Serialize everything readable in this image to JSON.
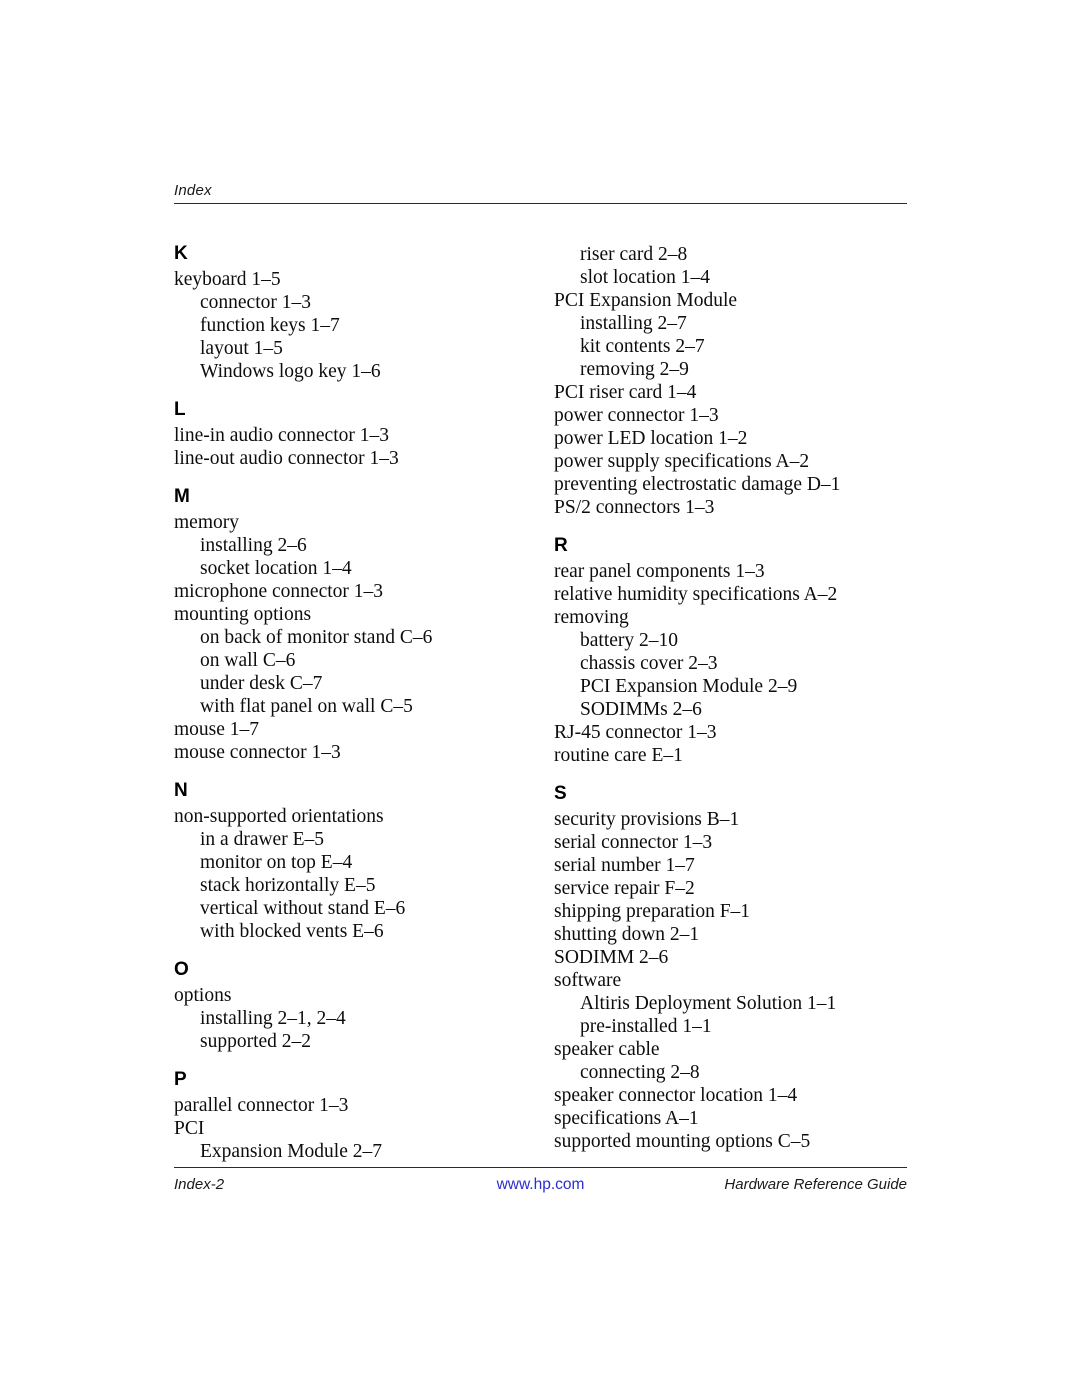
{
  "header": {
    "label": "Index"
  },
  "footer": {
    "left": "Index-2",
    "center": "www.hp.com",
    "right": "Hardware Reference Guide",
    "link_color": "#2c2cd4"
  },
  "columns": {
    "left": [
      {
        "type": "letter",
        "text": "K"
      },
      {
        "type": "entry",
        "level": 1,
        "text": "keyboard 1–5"
      },
      {
        "type": "entry",
        "level": 2,
        "text": "connector 1–3"
      },
      {
        "type": "entry",
        "level": 2,
        "text": "function keys 1–7"
      },
      {
        "type": "entry",
        "level": 2,
        "text": "layout 1–5"
      },
      {
        "type": "entry",
        "level": 2,
        "text": "Windows logo key 1–6"
      },
      {
        "type": "letter",
        "text": "L"
      },
      {
        "type": "entry",
        "level": 1,
        "text": "line-in audio connector 1–3"
      },
      {
        "type": "entry",
        "level": 1,
        "text": "line-out audio connector 1–3"
      },
      {
        "type": "letter",
        "text": "M"
      },
      {
        "type": "entry",
        "level": 1,
        "text": "memory"
      },
      {
        "type": "entry",
        "level": 2,
        "text": "installing 2–6"
      },
      {
        "type": "entry",
        "level": 2,
        "text": "socket location 1–4"
      },
      {
        "type": "entry",
        "level": 1,
        "text": "microphone connector 1–3"
      },
      {
        "type": "entry",
        "level": 1,
        "text": "mounting options"
      },
      {
        "type": "entry",
        "level": 2,
        "text": "on back of monitor stand C–6"
      },
      {
        "type": "entry",
        "level": 2,
        "text": "on wall C–6"
      },
      {
        "type": "entry",
        "level": 2,
        "text": "under desk C–7"
      },
      {
        "type": "entry",
        "level": 2,
        "text": "with flat panel on wall C–5"
      },
      {
        "type": "entry",
        "level": 1,
        "text": "mouse 1–7"
      },
      {
        "type": "entry",
        "level": 1,
        "text": "mouse connector 1–3"
      },
      {
        "type": "letter",
        "text": "N"
      },
      {
        "type": "entry",
        "level": 1,
        "text": "non-supported orientations"
      },
      {
        "type": "entry",
        "level": 2,
        "text": "in a drawer E–5"
      },
      {
        "type": "entry",
        "level": 2,
        "text": "monitor on top E–4"
      },
      {
        "type": "entry",
        "level": 2,
        "text": "stack horizontally E–5"
      },
      {
        "type": "entry",
        "level": 2,
        "text": "vertical without stand E–6"
      },
      {
        "type": "entry",
        "level": 2,
        "text": "with blocked vents E–6"
      },
      {
        "type": "letter",
        "text": "O"
      },
      {
        "type": "entry",
        "level": 1,
        "text": "options"
      },
      {
        "type": "entry",
        "level": 2,
        "text": "installing 2–1, 2–4"
      },
      {
        "type": "entry",
        "level": 2,
        "text": "supported 2–2"
      },
      {
        "type": "letter",
        "text": "P"
      },
      {
        "type": "entry",
        "level": 1,
        "text": "parallel connector 1–3"
      },
      {
        "type": "entry",
        "level": 1,
        "text": "PCI"
      },
      {
        "type": "entry",
        "level": 2,
        "text": "Expansion Module 2–7"
      }
    ],
    "right": [
      {
        "type": "entry",
        "level": 2,
        "text": "riser card 2–8"
      },
      {
        "type": "entry",
        "level": 2,
        "text": "slot location 1–4"
      },
      {
        "type": "entry",
        "level": 1,
        "text": "PCI Expansion Module"
      },
      {
        "type": "entry",
        "level": 2,
        "text": "installing 2–7"
      },
      {
        "type": "entry",
        "level": 2,
        "text": "kit contents 2–7"
      },
      {
        "type": "entry",
        "level": 2,
        "text": "removing 2–9"
      },
      {
        "type": "entry",
        "level": 1,
        "text": "PCI riser card 1–4"
      },
      {
        "type": "entry",
        "level": 1,
        "text": "power connector 1–3"
      },
      {
        "type": "entry",
        "level": 1,
        "text": "power LED location 1–2"
      },
      {
        "type": "entry",
        "level": 1,
        "text": "power supply specifications A–2"
      },
      {
        "type": "entry",
        "level": 1,
        "text": "preventing electrostatic damage D–1"
      },
      {
        "type": "entry",
        "level": 1,
        "text": "PS/2 connectors 1–3"
      },
      {
        "type": "letter",
        "text": "R"
      },
      {
        "type": "entry",
        "level": 1,
        "text": "rear panel components 1–3"
      },
      {
        "type": "entry",
        "level": 1,
        "text": "relative humidity specifications A–2"
      },
      {
        "type": "entry",
        "level": 1,
        "text": "removing"
      },
      {
        "type": "entry",
        "level": 2,
        "text": "battery 2–10"
      },
      {
        "type": "entry",
        "level": 2,
        "text": "chassis cover 2–3"
      },
      {
        "type": "entry",
        "level": 2,
        "text": "PCI Expansion Module 2–9"
      },
      {
        "type": "entry",
        "level": 2,
        "text": "SODIMMs 2–6"
      },
      {
        "type": "entry",
        "level": 1,
        "text": "RJ-45 connector 1–3"
      },
      {
        "type": "entry",
        "level": 1,
        "text": "routine care E–1"
      },
      {
        "type": "letter",
        "text": "S"
      },
      {
        "type": "entry",
        "level": 1,
        "text": "security provisions B–1"
      },
      {
        "type": "entry",
        "level": 1,
        "text": "serial connector 1–3"
      },
      {
        "type": "entry",
        "level": 1,
        "text": "serial number 1–7"
      },
      {
        "type": "entry",
        "level": 1,
        "text": "service repair F–2"
      },
      {
        "type": "entry",
        "level": 1,
        "text": "shipping preparation F–1"
      },
      {
        "type": "entry",
        "level": 1,
        "text": "shutting down 2–1"
      },
      {
        "type": "entry",
        "level": 1,
        "text": "SODIMM 2–6"
      },
      {
        "type": "entry",
        "level": 1,
        "text": "software"
      },
      {
        "type": "entry",
        "level": 2,
        "text": "Altiris Deployment Solution 1–1"
      },
      {
        "type": "entry",
        "level": 2,
        "text": "pre-installed 1–1"
      },
      {
        "type": "entry",
        "level": 1,
        "text": "speaker cable"
      },
      {
        "type": "entry",
        "level": 2,
        "text": "connecting 2–8"
      },
      {
        "type": "entry",
        "level": 1,
        "text": "speaker connector location 1–4"
      },
      {
        "type": "entry",
        "level": 1,
        "text": "specifications A–1"
      },
      {
        "type": "entry",
        "level": 1,
        "text": "supported mounting options C–5"
      }
    ]
  }
}
